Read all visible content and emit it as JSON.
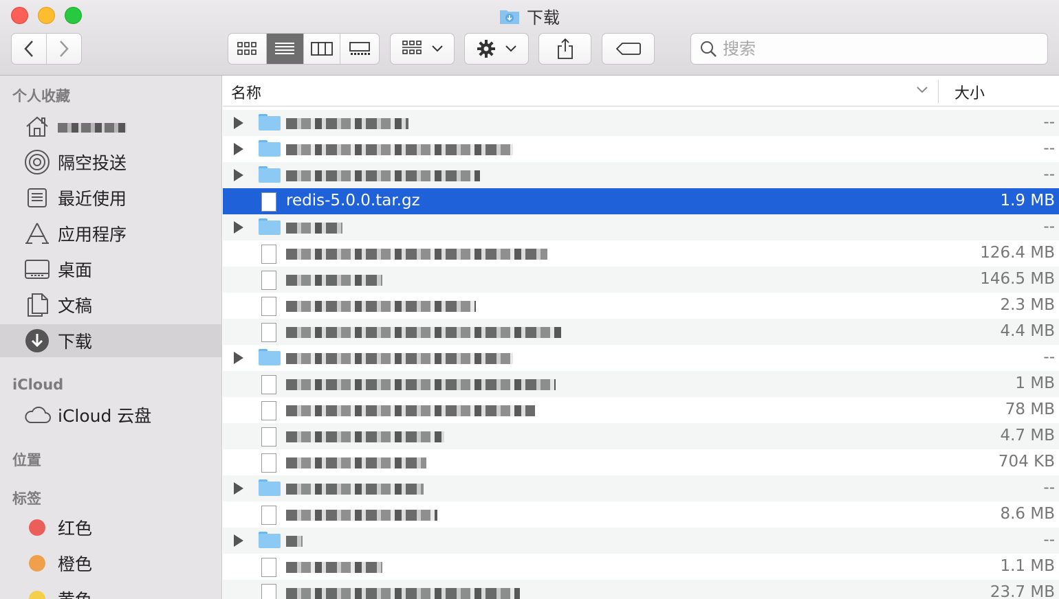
{
  "window": {
    "title": "下载"
  },
  "toolbar": {
    "back_label": "‹",
    "forward_label": "›",
    "view_modes": [
      "icon-view",
      "list-view",
      "column-view",
      "gallery-view"
    ],
    "active_view": "list-view",
    "search_placeholder": "搜索"
  },
  "sidebar": {
    "favorites_header": "个人收藏",
    "favorites": [
      {
        "label": "",
        "icon": "home-icon"
      },
      {
        "label": "隔空投送",
        "icon": "airdrop-icon"
      },
      {
        "label": "最近使用",
        "icon": "recents-icon"
      },
      {
        "label": "应用程序",
        "icon": "applications-icon"
      },
      {
        "label": "桌面",
        "icon": "desktop-icon"
      },
      {
        "label": "文稿",
        "icon": "documents-icon"
      },
      {
        "label": "下载",
        "icon": "downloads-icon",
        "selected": true
      }
    ],
    "icloud_header": "iCloud",
    "icloud_items": [
      {
        "label": "iCloud 云盘",
        "icon": "cloud-icon"
      }
    ],
    "locations_header": "位置",
    "tags_header": "标签",
    "tags": [
      {
        "label": "红色",
        "color": "#ec5f59"
      },
      {
        "label": "橙色",
        "color": "#f0a04b"
      },
      {
        "label": "黄色",
        "color": "#f5cf4a"
      }
    ]
  },
  "columns": {
    "name": "名称",
    "size": "大小"
  },
  "files": [
    {
      "kind": "folder",
      "name": "",
      "size": "--"
    },
    {
      "kind": "folder",
      "name": "",
      "size": "--"
    },
    {
      "kind": "folder",
      "name": "",
      "size": "--"
    },
    {
      "kind": "file",
      "name": "redis-5.0.0.tar.gz",
      "size": "1.9 MB",
      "selected": true
    },
    {
      "kind": "folder",
      "name": "",
      "size": "--"
    },
    {
      "kind": "file",
      "name": "",
      "size": "126.4 MB"
    },
    {
      "kind": "file",
      "name": "",
      "size": "146.5 MB"
    },
    {
      "kind": "file",
      "name": "",
      "size": "2.3 MB"
    },
    {
      "kind": "file",
      "name": "",
      "size": "4.4 MB"
    },
    {
      "kind": "folder",
      "name": "",
      "size": "--"
    },
    {
      "kind": "file",
      "name": "",
      "size": "1 MB"
    },
    {
      "kind": "file",
      "name": "",
      "size": "78 MB"
    },
    {
      "kind": "file",
      "name": "",
      "size": "4.7 MB"
    },
    {
      "kind": "file",
      "name": "",
      "size": "704 KB"
    },
    {
      "kind": "folder",
      "name": "",
      "size": "--"
    },
    {
      "kind": "file",
      "name": "",
      "size": "8.6 MB"
    },
    {
      "kind": "folder",
      "name": "",
      "size": "--"
    },
    {
      "kind": "file",
      "name": "",
      "size": "1.1 MB"
    },
    {
      "kind": "file",
      "name": "",
      "size": "23.7 MB"
    }
  ]
}
